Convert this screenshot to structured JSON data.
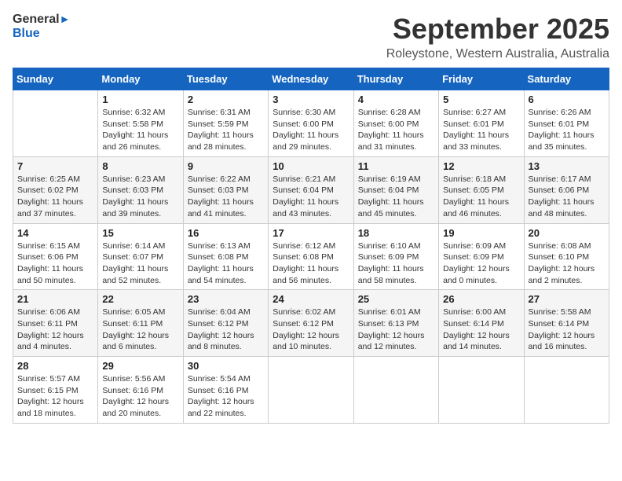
{
  "logo": {
    "line1": "General",
    "line2": "Blue"
  },
  "title": {
    "month_year": "September 2025",
    "location": "Roleystone, Western Australia, Australia"
  },
  "weekdays": [
    "Sunday",
    "Monday",
    "Tuesday",
    "Wednesday",
    "Thursday",
    "Friday",
    "Saturday"
  ],
  "weeks": [
    [
      {
        "day": "",
        "info": ""
      },
      {
        "day": "1",
        "info": "Sunrise: 6:32 AM\nSunset: 5:58 PM\nDaylight: 11 hours\nand 26 minutes."
      },
      {
        "day": "2",
        "info": "Sunrise: 6:31 AM\nSunset: 5:59 PM\nDaylight: 11 hours\nand 28 minutes."
      },
      {
        "day": "3",
        "info": "Sunrise: 6:30 AM\nSunset: 6:00 PM\nDaylight: 11 hours\nand 29 minutes."
      },
      {
        "day": "4",
        "info": "Sunrise: 6:28 AM\nSunset: 6:00 PM\nDaylight: 11 hours\nand 31 minutes."
      },
      {
        "day": "5",
        "info": "Sunrise: 6:27 AM\nSunset: 6:01 PM\nDaylight: 11 hours\nand 33 minutes."
      },
      {
        "day": "6",
        "info": "Sunrise: 6:26 AM\nSunset: 6:01 PM\nDaylight: 11 hours\nand 35 minutes."
      }
    ],
    [
      {
        "day": "7",
        "info": "Sunrise: 6:25 AM\nSunset: 6:02 PM\nDaylight: 11 hours\nand 37 minutes."
      },
      {
        "day": "8",
        "info": "Sunrise: 6:23 AM\nSunset: 6:03 PM\nDaylight: 11 hours\nand 39 minutes."
      },
      {
        "day": "9",
        "info": "Sunrise: 6:22 AM\nSunset: 6:03 PM\nDaylight: 11 hours\nand 41 minutes."
      },
      {
        "day": "10",
        "info": "Sunrise: 6:21 AM\nSunset: 6:04 PM\nDaylight: 11 hours\nand 43 minutes."
      },
      {
        "day": "11",
        "info": "Sunrise: 6:19 AM\nSunset: 6:04 PM\nDaylight: 11 hours\nand 45 minutes."
      },
      {
        "day": "12",
        "info": "Sunrise: 6:18 AM\nSunset: 6:05 PM\nDaylight: 11 hours\nand 46 minutes."
      },
      {
        "day": "13",
        "info": "Sunrise: 6:17 AM\nSunset: 6:06 PM\nDaylight: 11 hours\nand 48 minutes."
      }
    ],
    [
      {
        "day": "14",
        "info": "Sunrise: 6:15 AM\nSunset: 6:06 PM\nDaylight: 11 hours\nand 50 minutes."
      },
      {
        "day": "15",
        "info": "Sunrise: 6:14 AM\nSunset: 6:07 PM\nDaylight: 11 hours\nand 52 minutes."
      },
      {
        "day": "16",
        "info": "Sunrise: 6:13 AM\nSunset: 6:08 PM\nDaylight: 11 hours\nand 54 minutes."
      },
      {
        "day": "17",
        "info": "Sunrise: 6:12 AM\nSunset: 6:08 PM\nDaylight: 11 hours\nand 56 minutes."
      },
      {
        "day": "18",
        "info": "Sunrise: 6:10 AM\nSunset: 6:09 PM\nDaylight: 11 hours\nand 58 minutes."
      },
      {
        "day": "19",
        "info": "Sunrise: 6:09 AM\nSunset: 6:09 PM\nDaylight: 12 hours\nand 0 minutes."
      },
      {
        "day": "20",
        "info": "Sunrise: 6:08 AM\nSunset: 6:10 PM\nDaylight: 12 hours\nand 2 minutes."
      }
    ],
    [
      {
        "day": "21",
        "info": "Sunrise: 6:06 AM\nSunset: 6:11 PM\nDaylight: 12 hours\nand 4 minutes."
      },
      {
        "day": "22",
        "info": "Sunrise: 6:05 AM\nSunset: 6:11 PM\nDaylight: 12 hours\nand 6 minutes."
      },
      {
        "day": "23",
        "info": "Sunrise: 6:04 AM\nSunset: 6:12 PM\nDaylight: 12 hours\nand 8 minutes."
      },
      {
        "day": "24",
        "info": "Sunrise: 6:02 AM\nSunset: 6:12 PM\nDaylight: 12 hours\nand 10 minutes."
      },
      {
        "day": "25",
        "info": "Sunrise: 6:01 AM\nSunset: 6:13 PM\nDaylight: 12 hours\nand 12 minutes."
      },
      {
        "day": "26",
        "info": "Sunrise: 6:00 AM\nSunset: 6:14 PM\nDaylight: 12 hours\nand 14 minutes."
      },
      {
        "day": "27",
        "info": "Sunrise: 5:58 AM\nSunset: 6:14 PM\nDaylight: 12 hours\nand 16 minutes."
      }
    ],
    [
      {
        "day": "28",
        "info": "Sunrise: 5:57 AM\nSunset: 6:15 PM\nDaylight: 12 hours\nand 18 minutes."
      },
      {
        "day": "29",
        "info": "Sunrise: 5:56 AM\nSunset: 6:16 PM\nDaylight: 12 hours\nand 20 minutes."
      },
      {
        "day": "30",
        "info": "Sunrise: 5:54 AM\nSunset: 6:16 PM\nDaylight: 12 hours\nand 22 minutes."
      },
      {
        "day": "",
        "info": ""
      },
      {
        "day": "",
        "info": ""
      },
      {
        "day": "",
        "info": ""
      },
      {
        "day": "",
        "info": ""
      }
    ]
  ]
}
